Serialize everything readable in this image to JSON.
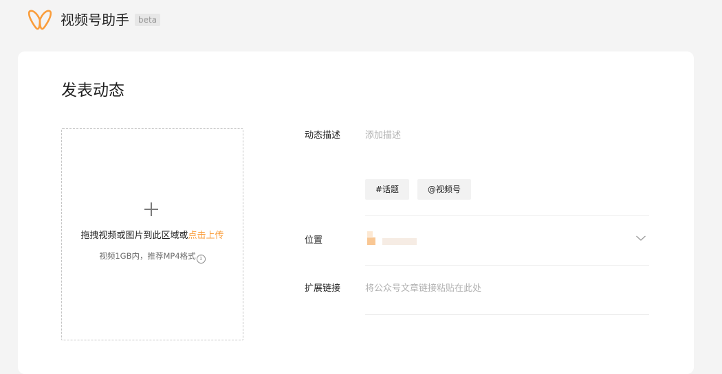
{
  "header": {
    "app_title": "视频号助手",
    "beta_badge": "beta",
    "logo_icon": "butterfly-logo-icon",
    "brand_color": "#fa9d3b"
  },
  "main": {
    "page_title": "发表动态",
    "upload": {
      "plus_icon": "plus-icon",
      "hint_text": "拖拽视频或图片到此区域或",
      "hint_link": "点击上传",
      "sub_text": "视频1GB内，推荐MP4格式",
      "info_icon": "info-icon"
    },
    "form": {
      "description": {
        "label": "动态描述",
        "placeholder": "添加描述",
        "value": ""
      },
      "tags": [
        {
          "label": "#话题"
        },
        {
          "label": "@视频号"
        }
      ],
      "location": {
        "label": "位置",
        "value_blurred": true,
        "chevron_icon": "chevron-down-icon"
      },
      "extended_link": {
        "label": "扩展链接",
        "placeholder": "将公众号文章链接粘贴在此处",
        "value": ""
      }
    }
  }
}
